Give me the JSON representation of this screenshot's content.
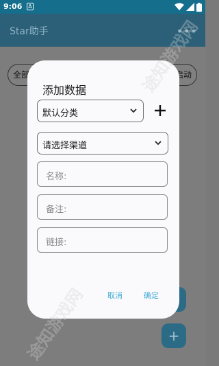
{
  "status_bar": {
    "time": "9:06",
    "notification_icon": "A",
    "icons": [
      "wifi-icon",
      "signal-icon",
      "battery-icon"
    ]
  },
  "app_bar": {
    "title": "Star助手",
    "menu_icon": "•••"
  },
  "background": {
    "chip_left": "全部",
    "chip_right": "启动",
    "fab_icon": "+"
  },
  "dialog": {
    "title": "添加数据",
    "category_select": {
      "value": "默认分类"
    },
    "channel_select": {
      "value": "请选择渠道"
    },
    "fields": {
      "name": "名称:",
      "note": "备注:",
      "link": "链接:"
    },
    "buttons": {
      "cancel": "取消",
      "confirm": "确定"
    }
  },
  "watermark": "途知游戏网",
  "colors": {
    "status_bar": "#146e8c",
    "accent_text": "#3fa9d3",
    "dialog_bg": "#fafafc"
  }
}
